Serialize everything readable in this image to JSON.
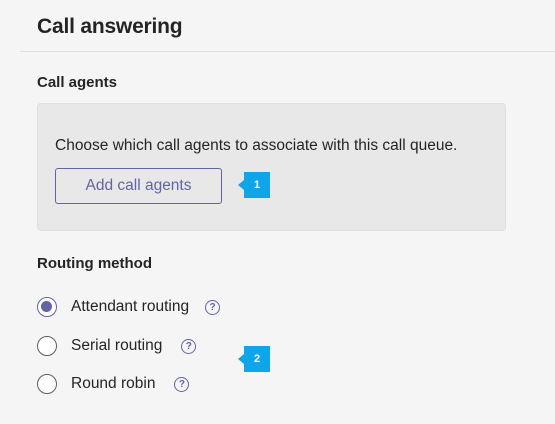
{
  "page": {
    "title": "Call answering"
  },
  "call_agents": {
    "heading": "Call agents",
    "description": "Choose which call agents to associate with this call queue.",
    "add_button_label": "Add call agents",
    "callout": "1"
  },
  "routing": {
    "heading": "Routing method",
    "selected": "Attendant routing",
    "options": [
      {
        "label": "Attendant routing",
        "checked": true
      },
      {
        "label": "Serial routing",
        "checked": false
      },
      {
        "label": "Round robin",
        "checked": false
      }
    ],
    "help_glyph": "?",
    "callout": "2"
  },
  "colors": {
    "accent": "#6264a7",
    "callout": "#0ea5e9",
    "panel": "#e8e8e8",
    "background": "#f5f5f5"
  },
  "icons": {
    "radio_selected": "radio-selected-icon",
    "radio_unselected": "radio-unselected-icon",
    "help": "help-circle-icon"
  }
}
